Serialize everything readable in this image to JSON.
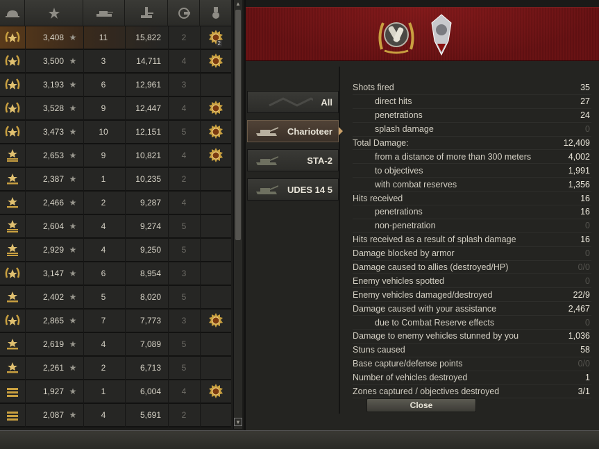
{
  "colors": {
    "accent_orange": "#c9a069",
    "banner_red": "#5a0f10",
    "medal_gold": "#c9a040"
  },
  "list": {
    "columns": [
      "rank-icon",
      "experience-star-icon",
      "tank-battles-icon",
      "damage-icon",
      "level-icon",
      "medal-icon"
    ],
    "rows": [
      {
        "rank": "gold-laurel",
        "exp": "3,408",
        "battles": "11",
        "damage": "15,822",
        "level": "2",
        "medal": true,
        "medal_count": "2",
        "selected": true
      },
      {
        "rank": "gold-laurel",
        "exp": "3,500",
        "battles": "3",
        "damage": "14,711",
        "level": "4",
        "medal": true,
        "medal_count": ""
      },
      {
        "rank": "gold-laurel",
        "exp": "3,193",
        "battles": "6",
        "damage": "12,961",
        "level": "3",
        "medal": false,
        "medal_count": ""
      },
      {
        "rank": "gold-laurel",
        "exp": "3,528",
        "battles": "9",
        "damage": "12,447",
        "level": "4",
        "medal": true,
        "medal_count": ""
      },
      {
        "rank": "gold-laurel",
        "exp": "3,473",
        "battles": "10",
        "damage": "12,151",
        "level": "5",
        "medal": true,
        "medal_count": ""
      },
      {
        "rank": "chevron-star",
        "exp": "2,653",
        "battles": "9",
        "damage": "10,821",
        "level": "4",
        "medal": true,
        "medal_count": ""
      },
      {
        "rank": "star-bar",
        "exp": "2,387",
        "battles": "1",
        "damage": "10,235",
        "level": "2",
        "medal": false,
        "medal_count": ""
      },
      {
        "rank": "star-bar",
        "exp": "2,466",
        "battles": "2",
        "damage": "9,287",
        "level": "4",
        "medal": false,
        "medal_count": ""
      },
      {
        "rank": "chevron-star",
        "exp": "2,604",
        "battles": "4",
        "damage": "9,274",
        "level": "5",
        "medal": false,
        "medal_count": ""
      },
      {
        "rank": "chevron-star",
        "exp": "2,929",
        "battles": "4",
        "damage": "9,250",
        "level": "5",
        "medal": false,
        "medal_count": ""
      },
      {
        "rank": "gold-laurel",
        "exp": "3,147",
        "battles": "6",
        "damage": "8,954",
        "level": "3",
        "medal": false,
        "medal_count": ""
      },
      {
        "rank": "star-bar",
        "exp": "2,402",
        "battles": "5",
        "damage": "8,020",
        "level": "5",
        "medal": false,
        "medal_count": ""
      },
      {
        "rank": "gold-laurel",
        "exp": "2,865",
        "battles": "7",
        "damage": "7,773",
        "level": "3",
        "medal": true,
        "medal_count": ""
      },
      {
        "rank": "star-bar",
        "exp": "2,619",
        "battles": "4",
        "damage": "7,089",
        "level": "5",
        "medal": false,
        "medal_count": ""
      },
      {
        "rank": "star-bar",
        "exp": "2,261",
        "battles": "2",
        "damage": "6,713",
        "level": "5",
        "medal": false,
        "medal_count": ""
      },
      {
        "rank": "bars",
        "exp": "1,927",
        "battles": "1",
        "damage": "6,004",
        "level": "4",
        "medal": true,
        "medal_count": ""
      },
      {
        "rank": "bars",
        "exp": "2,087",
        "battles": "4",
        "damage": "5,691",
        "level": "2",
        "medal": false,
        "medal_count": ""
      }
    ]
  },
  "tabs": [
    {
      "label": "All",
      "active": false,
      "icon": "camo-pattern-icon"
    },
    {
      "label": "Charioteer",
      "active": true,
      "icon": "tank-silhouette-icon"
    },
    {
      "label": "STA-2",
      "active": false,
      "icon": "tank-silhouette-icon"
    },
    {
      "label": "UDES 14 5",
      "active": false,
      "icon": "tank-silhouette-icon"
    }
  ],
  "stats": [
    {
      "label": "Shots fired",
      "value": "35",
      "indent": false,
      "dim": false
    },
    {
      "label": "direct hits",
      "value": "27",
      "indent": true,
      "dim": false
    },
    {
      "label": "penetrations",
      "value": "24",
      "indent": true,
      "dim": false
    },
    {
      "label": "splash damage",
      "value": "0",
      "indent": true,
      "dim": true
    },
    {
      "label": "Total Damage:",
      "value": "12,409",
      "indent": false,
      "dim": false
    },
    {
      "label": "from a distance of more than 300 meters",
      "value": "4,002",
      "indent": true,
      "dim": false
    },
    {
      "label": "to objectives",
      "value": "1,991",
      "indent": true,
      "dim": false
    },
    {
      "label": "with combat reserves",
      "value": "1,356",
      "indent": true,
      "dim": false
    },
    {
      "label": "Hits received",
      "value": "16",
      "indent": false,
      "dim": false
    },
    {
      "label": "penetrations",
      "value": "16",
      "indent": true,
      "dim": false
    },
    {
      "label": "non-penetration",
      "value": "0",
      "indent": true,
      "dim": true
    },
    {
      "label": "Hits received as a result of splash damage",
      "value": "16",
      "indent": false,
      "dim": false
    },
    {
      "label": "Damage blocked by armor",
      "value": "0",
      "indent": false,
      "dim": true
    },
    {
      "label": "Damage caused to allies (destroyed/HP)",
      "value": "0/0",
      "indent": false,
      "dim": true
    },
    {
      "label": "Enemy vehicles spotted",
      "value": "0",
      "indent": false,
      "dim": true
    },
    {
      "label": "Enemy vehicles damaged/destroyed",
      "value": "22/9",
      "indent": false,
      "dim": false
    },
    {
      "label": "Damage caused with your assistance",
      "value": "2,467",
      "indent": false,
      "dim": false
    },
    {
      "label": "due to Combat Reserve effects",
      "value": "0",
      "indent": true,
      "dim": true
    },
    {
      "label": "Damage to enemy vehicles stunned by you",
      "value": "1,036",
      "indent": false,
      "dim": false
    },
    {
      "label": "Stuns caused",
      "value": "58",
      "indent": false,
      "dim": false
    },
    {
      "label": "Base capture/defense points",
      "value": "0/0",
      "indent": false,
      "dim": true
    },
    {
      "label": "Number of vehicles destroyed",
      "value": "1",
      "indent": false,
      "dim": false
    },
    {
      "label": "Zones captured / objectives destroyed",
      "value": "3/1",
      "indent": false,
      "dim": false
    }
  ],
  "close_label": "Close"
}
